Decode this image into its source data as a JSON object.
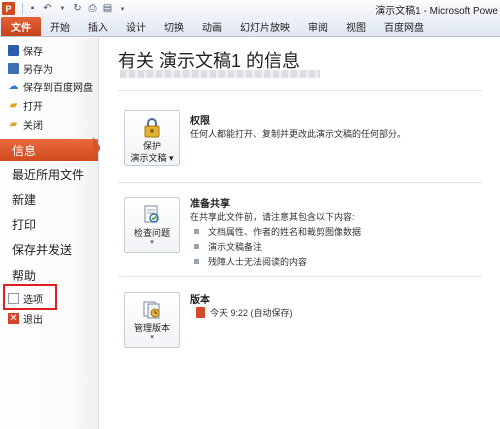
{
  "titlebar": {
    "app_icon": "P",
    "window_title": "演示文稿1 - Microsoft Powe",
    "qat": [
      "save-icon",
      "undo-icon",
      "redo-icon",
      "print-icon",
      "preview-icon",
      "customize-icon"
    ]
  },
  "tabs": [
    "文件",
    "开始",
    "插入",
    "设计",
    "切换",
    "动画",
    "幻灯片放映",
    "审阅",
    "视图",
    "百度网盘"
  ],
  "sidebar": {
    "commands_top": [
      {
        "label": "保存",
        "icon": "save-icon"
      },
      {
        "label": "另存为",
        "icon": "save-as-icon"
      },
      {
        "label": "保存到百度网盘",
        "icon": "baidu-cloud-icon"
      },
      {
        "label": "打开",
        "icon": "open-folder-icon"
      },
      {
        "label": "关闭",
        "icon": "close-folder-icon"
      }
    ],
    "nav": [
      "信息",
      "最近所用文件",
      "新建",
      "打印",
      "保存并发送",
      "帮助"
    ],
    "active": "信息",
    "commands_bottom": [
      {
        "label": "选项",
        "icon": "options-icon"
      },
      {
        "label": "退出",
        "icon": "exit-icon"
      }
    ]
  },
  "main": {
    "title": "有关 演示文稿1 的信息",
    "permissions": {
      "button_line1": "保护",
      "button_line2": "演示文稿",
      "title": "权限",
      "desc": "任何人都能打开、复制并更改此演示文稿的任何部分。"
    },
    "prepare": {
      "button_label": "检查问题",
      "title": "准备共享",
      "desc": "在共享此文件前，请注意其包含以下内容:",
      "bullets": [
        "文档属性、作者的姓名和裁剪图像数据",
        "演示文稿备注",
        "残障人士无法阅读的内容"
      ]
    },
    "versions": {
      "button_label": "管理版本",
      "title": "版本",
      "entry": "今天 9:22 (自动保存)"
    }
  },
  "colors": {
    "accent": "#d24a1f",
    "highlight_box": "#e02020"
  }
}
